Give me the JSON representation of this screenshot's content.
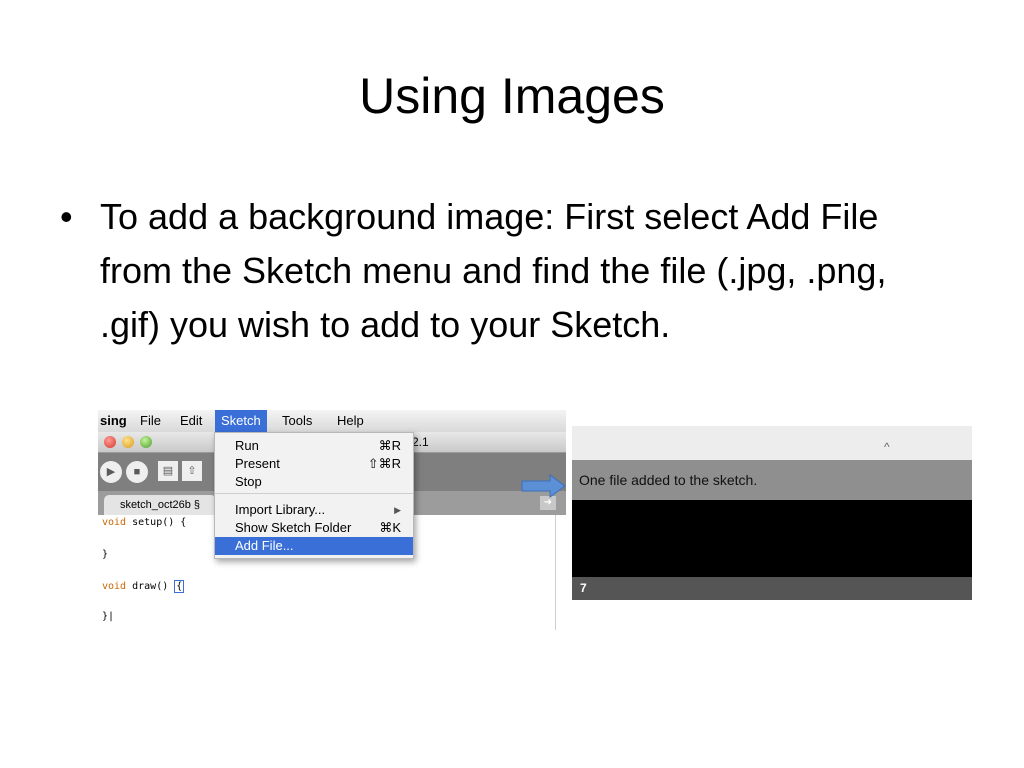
{
  "slide": {
    "title": "Using Images",
    "bullet_char": "•",
    "bullet_text": "To add a background image: First select Add File from the Sketch menu and find the file (.jpg, .png, .gif) you wish to add to your Sketch."
  },
  "left_screenshot": {
    "menubar": {
      "app": "sing",
      "file": "File",
      "edit": "Edit",
      "sketch": "Sketch",
      "tools": "Tools",
      "help": "Help"
    },
    "window_version": "2.1",
    "tab_label": "sketch_oct26b §",
    "code_lines": [
      {
        "kw": "void",
        "rest": " setup() {"
      },
      {
        "kw": "",
        "rest": "}"
      },
      {
        "kw": "void",
        "rest": " draw() ",
        "cursor": "{"
      },
      {
        "kw": "",
        "rest": "}|"
      }
    ],
    "sketch_menu": {
      "run": "Run",
      "run_shortcut": "⌘R",
      "present": "Present",
      "present_shortcut": "⇧⌘R",
      "stop": "Stop",
      "import_library": "Import Library...",
      "import_arrow": "▶",
      "show_folder": "Show Sketch Folder",
      "show_folder_shortcut": "⌘K",
      "add_file": "Add File..."
    }
  },
  "right_screenshot": {
    "handle": "^",
    "status_message": "One file added to the sketch.",
    "line_number": "7"
  },
  "colors": {
    "menu_highlight": "#3a6fd8",
    "arrow": "#5b8fd6",
    "keyword": "#cc6600"
  },
  "icons": [
    "run-icon",
    "stop-icon",
    "new-icon",
    "open-icon",
    "traffic-light-close",
    "traffic-light-minimize",
    "traffic-light-zoom",
    "tab-arrow-icon",
    "submenu-arrow-icon",
    "callout-arrow"
  ]
}
